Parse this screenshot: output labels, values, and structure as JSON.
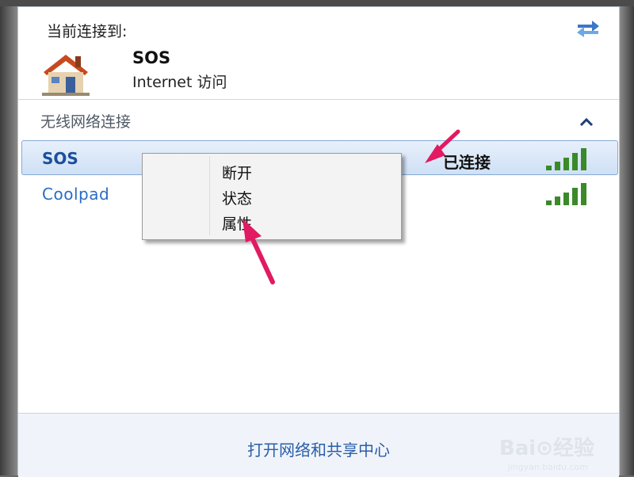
{
  "header": {
    "current_label": "当前连接到:"
  },
  "current_network": {
    "name": "SOS",
    "access": "Internet 访问"
  },
  "wireless_section": {
    "title": "无线网络连接"
  },
  "networks": [
    {
      "name": "SOS",
      "status": "已连接"
    },
    {
      "name": "Coolpad",
      "status": ""
    }
  ],
  "context_menu": {
    "items": [
      "断开",
      "状态",
      "属性"
    ]
  },
  "footer": {
    "link": "打开网络和共享中心"
  },
  "watermark": {
    "brand": "Bai⊙经验",
    "url": "jingyan.baidu.com"
  },
  "colors": {
    "accent": "#1b4f9c",
    "signal": "#3a8a2a",
    "annotation_arrow": "#e11a62"
  }
}
